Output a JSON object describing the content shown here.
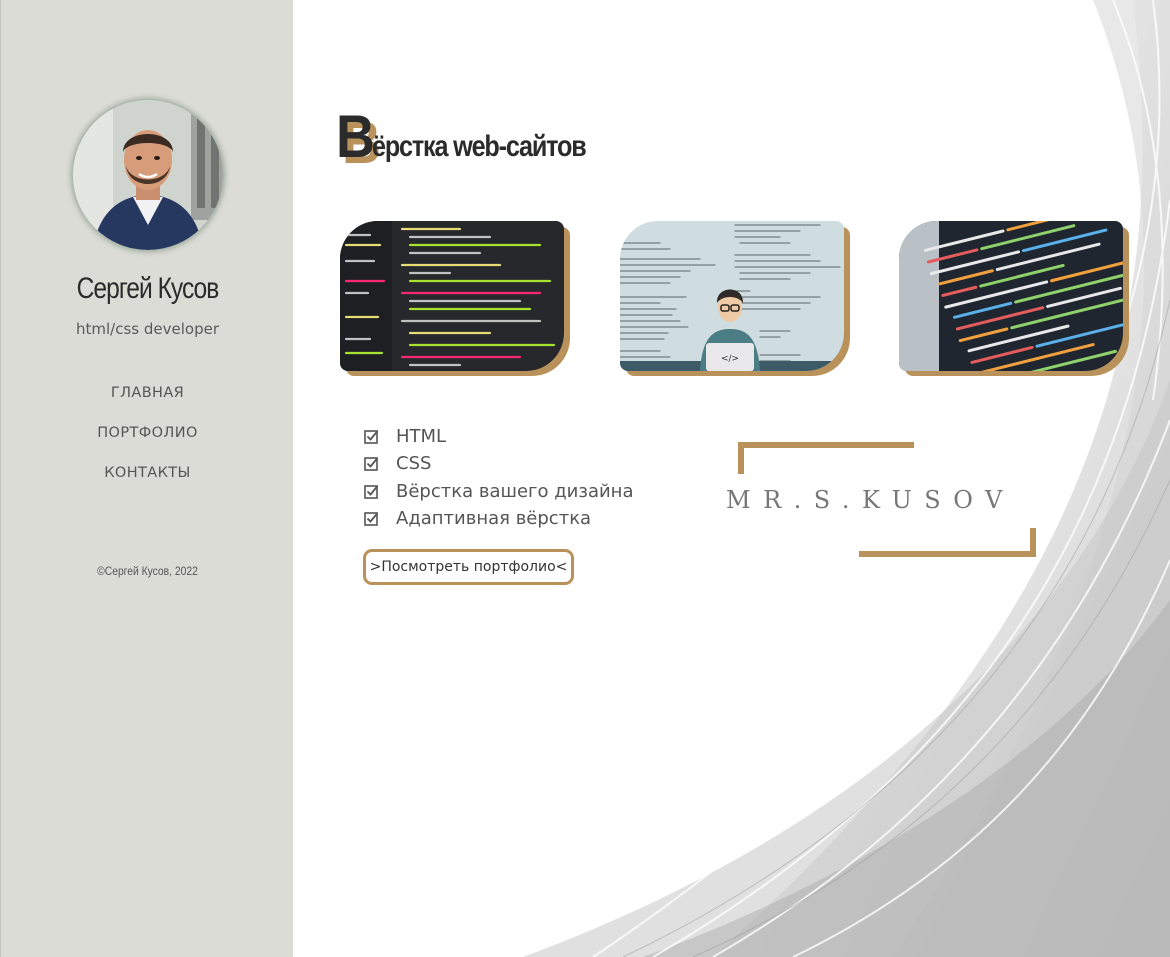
{
  "sidebar": {
    "name": "Сергей Кусов",
    "role": "html/css developer",
    "nav": [
      {
        "label": "ГЛАВНАЯ"
      },
      {
        "label": "ПОРТФОЛИО"
      },
      {
        "label": "КОНТАКТЫ"
      }
    ],
    "copyright": "©Сергей Кусов, 2022"
  },
  "main": {
    "heading_initial": "В",
    "heading_rest": "ёрстка web-сайтов",
    "skills": [
      {
        "label": "HTML"
      },
      {
        "label": "CSS"
      },
      {
        "label": "Вёрстка вашего дизайна"
      },
      {
        "label": "Адаптивная вёрстка"
      }
    ],
    "portfolio_button": ">Посмотреть портфолио<",
    "logo_text": "MR.S.KUSOV"
  },
  "colors": {
    "accent": "#b8925a",
    "sidebar_bg": "#dcdcd7",
    "text": "#444444"
  },
  "icons": [
    "checkbox-checked-icon"
  ]
}
